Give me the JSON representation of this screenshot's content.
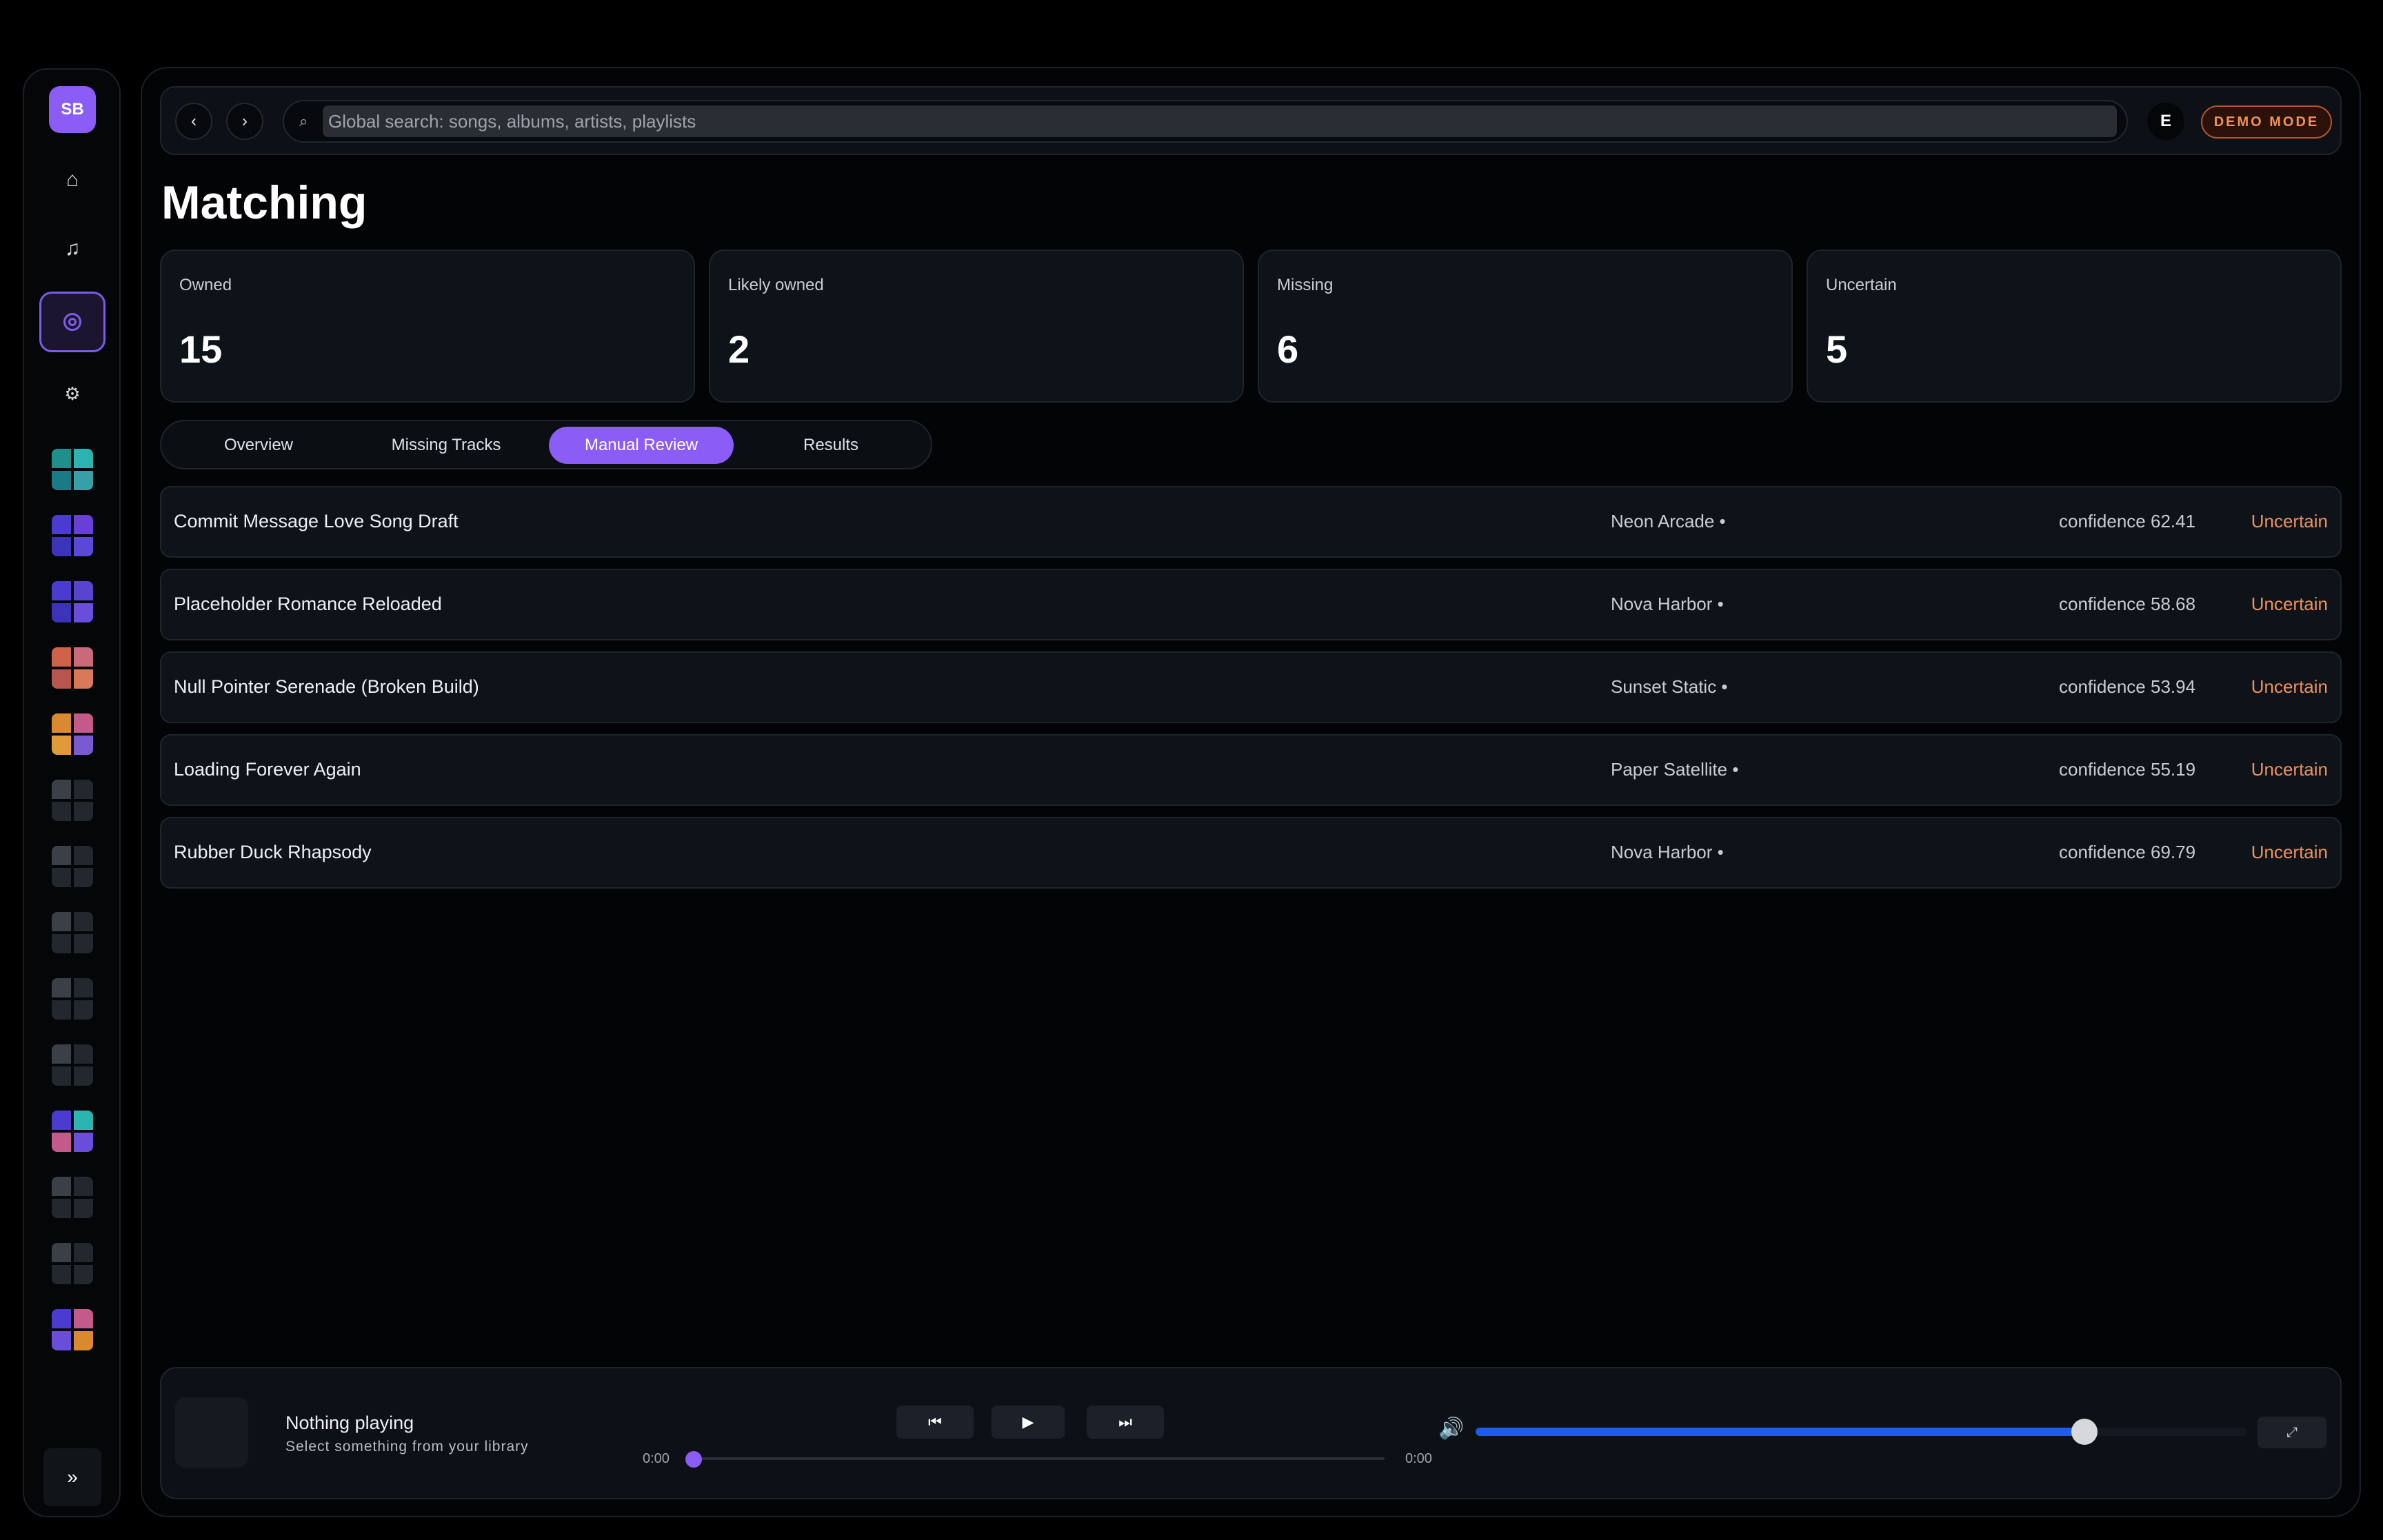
{
  "sidebar": {
    "avatar": "SB",
    "nav_icons": [
      "home-icon",
      "music-note-icon",
      "matching-ring-icon",
      "gear-icon"
    ],
    "expand_label": "»",
    "playlist_tiles": [
      {
        "colors": [
          "#1f8f8a",
          "#2bb5b0",
          "#1a7a86",
          "#36a0a6"
        ]
      },
      {
        "colors": [
          "#4b3bd1",
          "#6a3fd8",
          "#3b34b8",
          "#5a48d6"
        ]
      },
      {
        "colors": [
          "#4b3bd1",
          "#5a44cf",
          "#3b34b8",
          "#6a4ed9"
        ]
      },
      {
        "colors": [
          "#d0624a",
          "#c86a7a",
          "#b8554e",
          "#d87a5a"
        ]
      },
      {
        "colors": [
          "#d98a2f",
          "#c45a8a",
          "#e09a3a",
          "#7a5ad0"
        ]
      },
      {
        "colors": [
          "#3a3f48",
          "#23272e",
          "#23272e",
          "#23272e"
        ]
      },
      {
        "colors": [
          "#3a3f48",
          "#23272e",
          "#23272e",
          "#23272e"
        ]
      },
      {
        "colors": [
          "#3a3f48",
          "#23272e",
          "#23272e",
          "#23272e"
        ]
      },
      {
        "colors": [
          "#3a3f48",
          "#23272e",
          "#23272e",
          "#23272e"
        ]
      },
      {
        "colors": [
          "#3a3f48",
          "#23272e",
          "#23272e",
          "#23272e"
        ]
      },
      {
        "colors": [
          "#4b3bd1",
          "#2bb5b0",
          "#c45a8a",
          "#6a4ed9"
        ]
      },
      {
        "colors": [
          "#3a3f48",
          "#23272e",
          "#23272e",
          "#23272e"
        ]
      },
      {
        "colors": [
          "#3a3f48",
          "#23272e",
          "#23272e",
          "#23272e"
        ]
      },
      {
        "colors": [
          "#4b3bd1",
          "#c45a8a",
          "#6a4ed9",
          "#d98a2f"
        ]
      }
    ]
  },
  "topbar": {
    "back_label": "‹",
    "forward_label": "›",
    "search_icon": "⌕",
    "search_placeholder": "Global search: songs, albums, artists, playlists",
    "user_initial": "E",
    "demo_badge": "DEMO MODE"
  },
  "page": {
    "title": "Matching"
  },
  "stats": [
    {
      "label": "Owned",
      "value": "15"
    },
    {
      "label": "Likely owned",
      "value": "2"
    },
    {
      "label": "Missing",
      "value": "6"
    },
    {
      "label": "Uncertain",
      "value": "5"
    }
  ],
  "tabs": [
    {
      "label": "Overview",
      "active": false
    },
    {
      "label": "Missing Tracks",
      "active": false
    },
    {
      "label": "Manual Review",
      "active": true
    },
    {
      "label": "Results",
      "active": false
    }
  ],
  "review_rows": [
    {
      "title": "Commit Message Love Song Draft",
      "artist": "Neon Arcade •",
      "confidence": "confidence 62.41",
      "status": "Uncertain"
    },
    {
      "title": "Placeholder Romance Reloaded",
      "artist": "Nova Harbor •",
      "confidence": "confidence 58.68",
      "status": "Uncertain"
    },
    {
      "title": "Null Pointer Serenade (Broken Build)",
      "artist": "Sunset Static •",
      "confidence": "confidence 53.94",
      "status": "Uncertain"
    },
    {
      "title": "Loading Forever Again",
      "artist": "Paper Satellite •",
      "confidence": "confidence 55.19",
      "status": "Uncertain"
    },
    {
      "title": "Rubber Duck Rhapsody",
      "artist": "Nova Harbor •",
      "confidence": "confidence 69.79",
      "status": "Uncertain"
    }
  ],
  "player": {
    "title": "Nothing playing",
    "subtitle": "Select something from your library",
    "prev_label": "⏮",
    "play_label": "▶",
    "next_label": "⏭",
    "time_current": "0:00",
    "time_total": "0:00",
    "progress": 0,
    "volume_icon": "🔊",
    "volume_level": 0.79,
    "fullscreen_label": "⤢"
  },
  "colors": {
    "accent": "#8b5cf6",
    "status_uncertain": "#f0915b",
    "volume_fill": "#1e5cf0"
  }
}
